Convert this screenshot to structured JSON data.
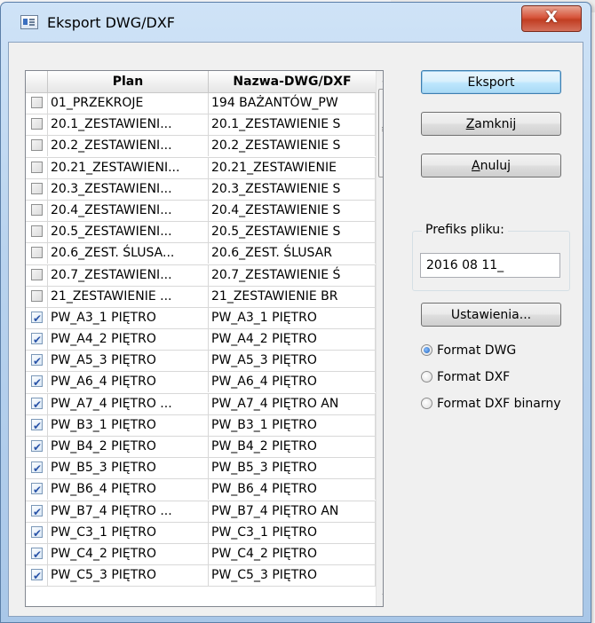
{
  "window": {
    "title": "Eksport DWG/DXF",
    "close_label": "X"
  },
  "list": {
    "columns": [
      "Plan",
      "Nazwa-DWG/DXF"
    ],
    "rows": [
      {
        "checked": false,
        "plan": "01_PRZEKROJE",
        "name": "194 BAŻANTÓW_PW"
      },
      {
        "checked": false,
        "plan": "20.1_ZESTAWIENI...",
        "name": "20.1_ZESTAWIENIE S"
      },
      {
        "checked": false,
        "plan": "20.2_ZESTAWIENI...",
        "name": "20.2_ZESTAWIENIE S"
      },
      {
        "checked": false,
        "plan": "20.21_ZESTAWIENI...",
        "name": "20.21_ZESTAWIENIE"
      },
      {
        "checked": false,
        "plan": "20.3_ZESTAWIENI...",
        "name": "20.3_ZESTAWIENIE S"
      },
      {
        "checked": false,
        "plan": "20.4_ZESTAWIENI...",
        "name": "20.4_ZESTAWIENIE S"
      },
      {
        "checked": false,
        "plan": "20.5_ZESTAWIENI...",
        "name": "20.5_ZESTAWIENIE S"
      },
      {
        "checked": false,
        "plan": "20.6_ZEST. ŚLUSA...",
        "name": "20.6_ZEST. ŚLUSAR"
      },
      {
        "checked": false,
        "plan": "20.7_ZESTAWIENI...",
        "name": "20.7_ZESTAWIENIE Ś"
      },
      {
        "checked": false,
        "plan": "21_ZESTAWIENIE ...",
        "name": "21_ZESTAWIENIE BR"
      },
      {
        "checked": true,
        "plan": "PW_A3_1 PIĘTRO",
        "name": "PW_A3_1 PIĘTRO"
      },
      {
        "checked": true,
        "plan": "PW_A4_2 PIĘTRO",
        "name": "PW_A4_2 PIĘTRO"
      },
      {
        "checked": true,
        "plan": "PW_A5_3 PIĘTRO",
        "name": "PW_A5_3 PIĘTRO"
      },
      {
        "checked": true,
        "plan": "PW_A6_4 PIĘTRO",
        "name": "PW_A6_4 PIĘTRO"
      },
      {
        "checked": true,
        "plan": "PW_A7_4 PIĘTRO ...",
        "name": "PW_A7_4 PIĘTRO AN"
      },
      {
        "checked": true,
        "plan": "PW_B3_1 PIĘTRO",
        "name": "PW_B3_1 PIĘTRO"
      },
      {
        "checked": true,
        "plan": "PW_B4_2 PIĘTRO",
        "name": "PW_B4_2 PIĘTRO"
      },
      {
        "checked": true,
        "plan": "PW_B5_3 PIĘTRO",
        "name": "PW_B5_3 PIĘTRO"
      },
      {
        "checked": true,
        "plan": "PW_B6_4 PIĘTRO",
        "name": "PW_B6_4 PIĘTRO"
      },
      {
        "checked": true,
        "plan": "PW_B7_4 PIĘTRO ...",
        "name": "PW_B7_4 PIĘTRO AN"
      },
      {
        "checked": true,
        "plan": "PW_C3_1 PIĘTRO",
        "name": "PW_C3_1 PIĘTRO"
      },
      {
        "checked": true,
        "plan": "PW_C4_2 PIĘTRO",
        "name": "PW_C4_2 PIĘTRO"
      },
      {
        "checked": true,
        "plan": "PW_C5_3 PIĘTRO",
        "name": "PW_C5_3 PIĘTRO"
      }
    ]
  },
  "buttons": {
    "export": "Eksport",
    "close_pre": "",
    "close_key": "Z",
    "close_post": "amknij",
    "cancel_pre": "",
    "cancel_key": "A",
    "cancel_post": "nuluj",
    "settings": "Ustawienia..."
  },
  "prefix": {
    "label": "Prefiks pliku:",
    "value": "2016 08 11_"
  },
  "formats": [
    {
      "label": "Format DWG",
      "selected": true
    },
    {
      "label": "Format DXF",
      "selected": false
    },
    {
      "label": "Format DXF binarny",
      "selected": false
    }
  ],
  "icons": {
    "app": "app-window-icon",
    "close": "close-icon",
    "scroll_up": "scroll-up-arrow-icon",
    "scroll_down": "scroll-down-arrow-icon"
  }
}
